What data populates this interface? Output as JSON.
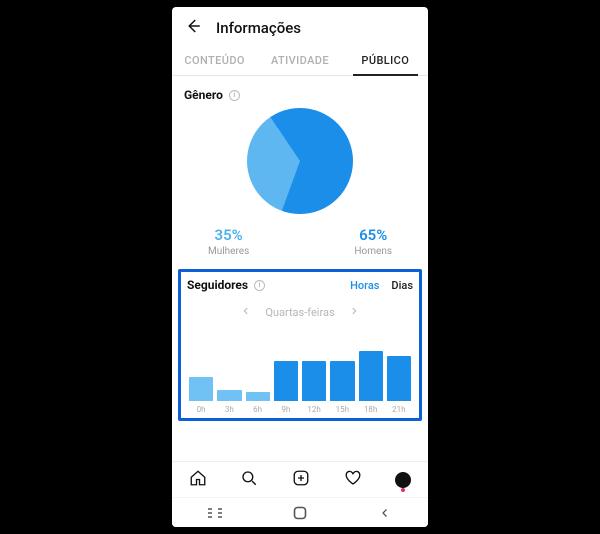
{
  "header": {
    "title": "Informações"
  },
  "tabs": {
    "content": "CONTEÚDO",
    "activity": "ATIVIDADE",
    "audience": "PÚBLICO"
  },
  "gender": {
    "title": "Gênero",
    "female_pct": "35%",
    "female_label": "Mulheres",
    "male_pct": "65%",
    "male_label": "Homens"
  },
  "followers": {
    "title": "Seguidores",
    "toggle_hours": "Horas",
    "toggle_days": "Dias",
    "day": "Quartas-feiras"
  },
  "colors": {
    "female": "#5eb7f0",
    "male": "#1a8ee8",
    "bar_light": "#6fc2f3",
    "bar_dark": "#1a8ee8",
    "highlight": "#0b60d6"
  },
  "chart_data": [
    {
      "type": "pie",
      "title": "Gênero",
      "series": [
        {
          "name": "Mulheres",
          "value": 35,
          "color": "#5eb7f0"
        },
        {
          "name": "Homens",
          "value": 65,
          "color": "#1a8ee8"
        }
      ]
    },
    {
      "type": "bar",
      "title": "Seguidores — Quartas-feiras (Horas)",
      "xlabel": "",
      "ylabel": "",
      "categories": [
        "0h",
        "3h",
        "6h",
        "9h",
        "12h",
        "15h",
        "18h",
        "21h"
      ],
      "values": [
        33,
        15,
        12,
        55,
        55,
        55,
        70,
        62
      ],
      "ylim": [
        0,
        100
      ]
    }
  ],
  "pie_gradient": "conic-gradient(from 200deg, #5eb7f0 0deg 126deg, #1a8ee8 126deg 360deg)",
  "bar_heights": [
    "33%",
    "15%",
    "12%",
    "55%",
    "55%",
    "55%",
    "70%",
    "62%"
  ],
  "bar_colors": [
    "#6fc2f3",
    "#6fc2f3",
    "#6fc2f3",
    "#1a8ee8",
    "#1a8ee8",
    "#1a8ee8",
    "#1a8ee8",
    "#1a8ee8"
  ]
}
